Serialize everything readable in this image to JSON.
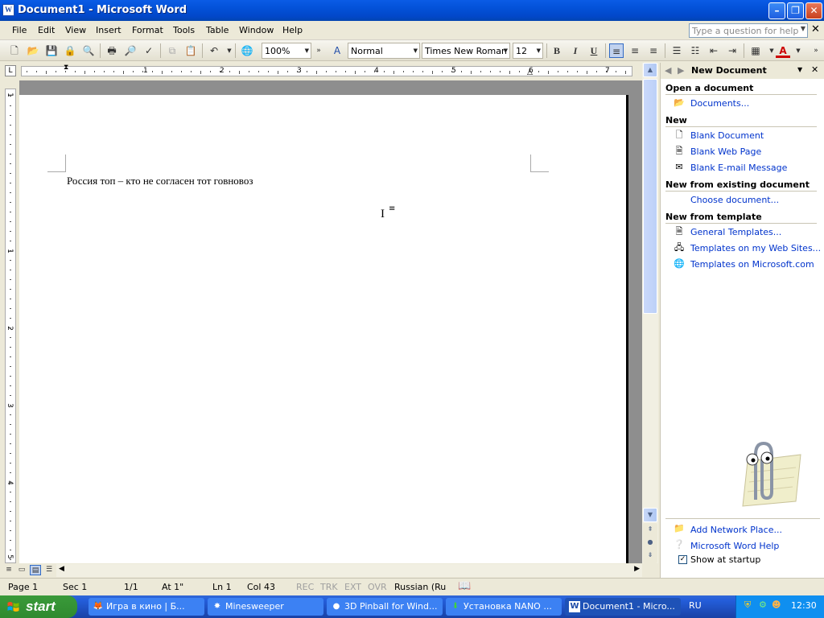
{
  "window": {
    "title": "Document1 - Microsoft Word",
    "app_icon": "word-icon"
  },
  "menu": {
    "items": [
      "File",
      "Edit",
      "View",
      "Insert",
      "Format",
      "Tools",
      "Table",
      "Window",
      "Help"
    ],
    "help_placeholder": "Type a question for help"
  },
  "toolbar": {
    "zoom": "100%",
    "style": "Normal",
    "font": "Times New Roman",
    "size": "12",
    "bold": "B",
    "italic": "I",
    "underline": "U"
  },
  "ruler": {
    "numbers": [
      "1",
      "2",
      "3",
      "4",
      "5",
      "6",
      "7"
    ],
    "vnumbers": [
      "1",
      "1",
      "2",
      "3",
      "4",
      "5"
    ]
  },
  "document": {
    "text": "Россия топ – кто не согласен тот говновоз"
  },
  "taskpane": {
    "title": "New Document",
    "open_heading": "Open a document",
    "open_links": [
      "Documents..."
    ],
    "new_heading": "New",
    "new_links": [
      "Blank Document",
      "Blank Web Page",
      "Blank E-mail Message"
    ],
    "existing_heading": "New from existing document",
    "existing_links": [
      "Choose document..."
    ],
    "template_heading": "New from template",
    "template_links": [
      "General Templates...",
      "Templates on my Web Sites...",
      "Templates on Microsoft.com"
    ],
    "bottom_links": [
      "Add Network Place...",
      "Microsoft Word Help"
    ],
    "show_startup": "Show at startup",
    "show_startup_checked": true
  },
  "status": {
    "page": "Page 1",
    "sec": "Sec 1",
    "pages": "1/1",
    "at": "At 1\"",
    "ln": "Ln 1",
    "col": "Col 43",
    "rec": "REC",
    "trk": "TRK",
    "ext": "EXT",
    "ovr": "OVR",
    "lang": "Russian (Ru"
  },
  "taskbar": {
    "start": "start",
    "tasks": [
      "Игра в кино | Б...",
      "Minesweeper",
      "3D Pinball for Wind...",
      "Установка NANO ...",
      "Document1 - Micro..."
    ],
    "lang": "RU",
    "clock": "12:30"
  }
}
